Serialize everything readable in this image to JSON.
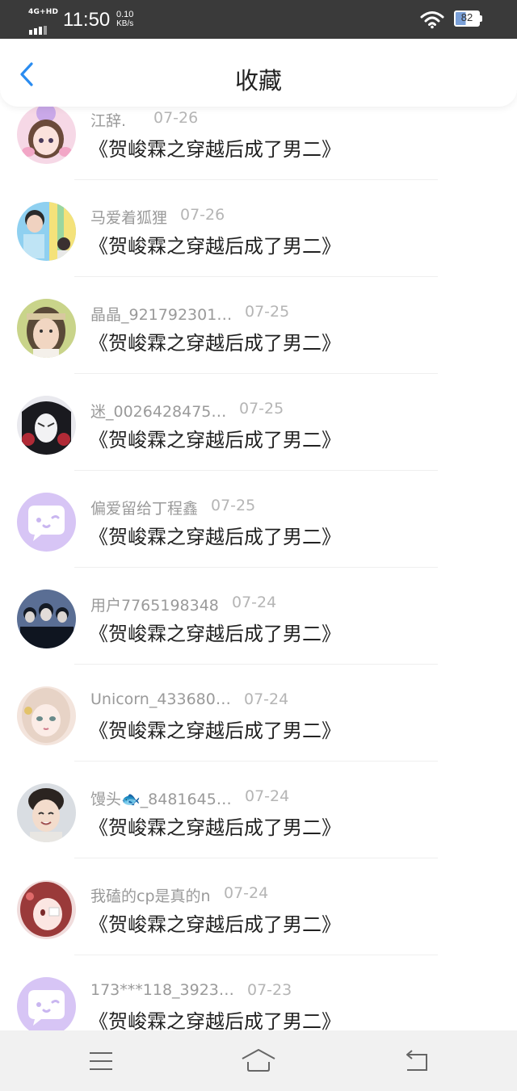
{
  "status_bar": {
    "network": "4G+HD",
    "time": "11:50",
    "speed_value": "0.10",
    "speed_unit": "KB/s",
    "battery": "82"
  },
  "header": {
    "title": "收藏"
  },
  "colors": {
    "accent": "#2a8cf0",
    "status_bar_bg": "#3a3a3a",
    "default_avatar": "#d7c5f5"
  },
  "items": [
    {
      "name": "江辞.",
      "date": "07-26",
      "title": "《贺峻霖之穿越后成了男二》",
      "avatar": "anime-girl-pink"
    },
    {
      "name": "马爱着狐狸",
      "date": "07-26",
      "title": "《贺峻霖之穿越后成了男二》",
      "avatar": "photo-boy-colorful"
    },
    {
      "name": "晶晶_921792301…",
      "date": "07-25",
      "title": "《贺峻霖之穿越后成了男二》",
      "avatar": "photo-boy-headband"
    },
    {
      "name": "迷_0026428475…",
      "date": "07-25",
      "title": "《贺峻霖之穿越后成了男二》",
      "avatar": "anime-dark-hair"
    },
    {
      "name": "偏爱留给丁程鑫",
      "date": "07-25",
      "title": "《贺峻霖之穿越后成了男二》",
      "avatar": "default-chat"
    },
    {
      "name": "用户7765198348",
      "date": "07-24",
      "title": "《贺峻霖之穿越后成了男二》",
      "avatar": "photo-group-dark"
    },
    {
      "name": "Unicorn_433680…",
      "date": "07-24",
      "title": "《贺峻霖之穿越后成了男二》",
      "avatar": "anime-girl-light"
    },
    {
      "name": "馒头🐟_8481645…",
      "date": "07-24",
      "title": "《贺峻霖之穿越后成了男二》",
      "avatar": "photo-boy-smile"
    },
    {
      "name": "我磕的cp是真的n",
      "date": "07-24",
      "title": "《贺峻霖之穿越后成了男二》",
      "avatar": "anime-girl-red"
    },
    {
      "name": "173***118_3923…",
      "date": "07-23",
      "title": "《贺峻霖之穿越后成了男二》",
      "avatar": "default-chat"
    }
  ],
  "nav_bar": {
    "menu_icon": "menu-icon",
    "home_icon": "home-icon",
    "back_icon": "back-icon"
  }
}
